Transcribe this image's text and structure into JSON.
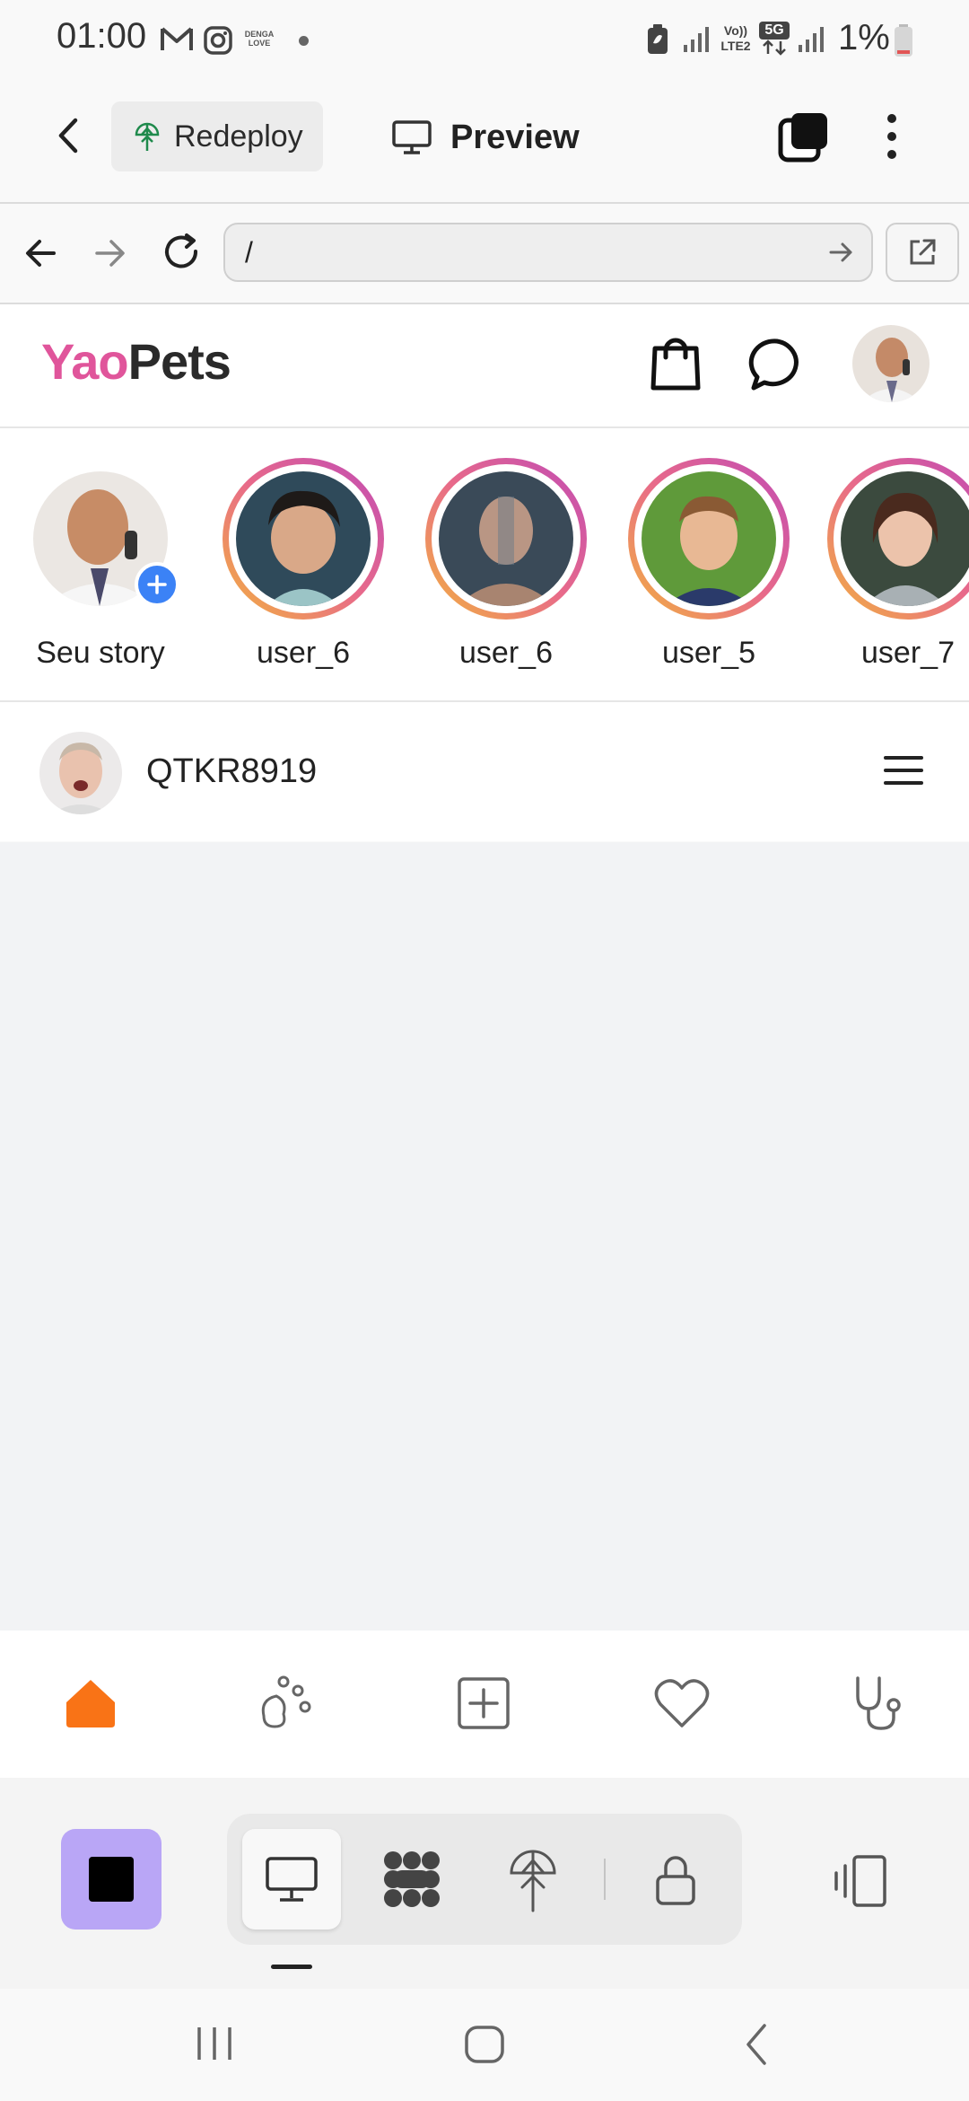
{
  "status_bar": {
    "time": "01:00",
    "battery_percent": "1%",
    "notification_icons": [
      "gmail-icon",
      "instagram-icon",
      "denga-love-icon",
      "dot-icon"
    ],
    "system_icons": [
      "battery-saver-icon",
      "signal-icon",
      "volte-icon",
      "5g-icon",
      "signal-icon",
      "battery-icon"
    ],
    "network_volte": "Vo)) LTE2",
    "network_5g": "5G",
    "app_badge_text": "DENGA LOVE"
  },
  "app_toolbar": {
    "redeploy_label": "Redeploy",
    "preview_label": "Preview"
  },
  "browser": {
    "url": "/"
  },
  "site": {
    "brand_part1": "Yao",
    "brand_part2": "Pets",
    "brand_color": "#e0559b"
  },
  "stories": [
    {
      "label": "Seu story",
      "own": true
    },
    {
      "label": "user_6"
    },
    {
      "label": "user_6"
    },
    {
      "label": "user_5"
    },
    {
      "label": "user_7"
    }
  ],
  "post": {
    "username": "QTKR8919"
  },
  "bottom_nav": {
    "items": [
      "home-icon",
      "paw-icon",
      "add-post-icon",
      "heart-icon",
      "stethoscope-icon"
    ],
    "active": "home-icon",
    "active_color": "#f97316"
  },
  "preview_toolbar": {
    "stop_color": "#b9a6f6",
    "modes": [
      "desktop-icon",
      "network-icon",
      "deploy-icon",
      "lock-icon"
    ],
    "active_mode": "desktop-icon"
  }
}
